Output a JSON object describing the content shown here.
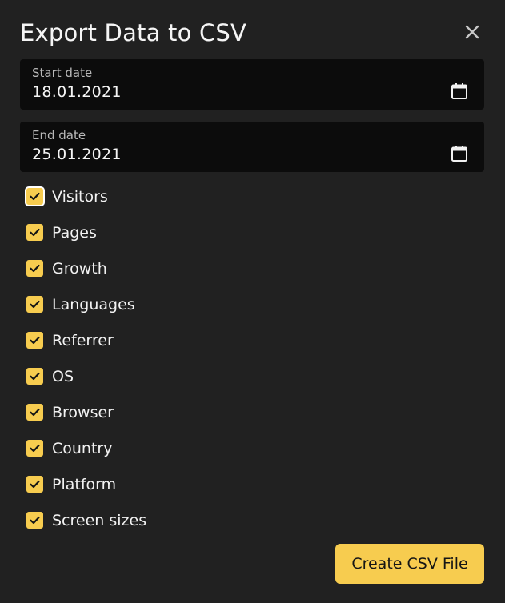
{
  "dialog": {
    "title": "Export Data to CSV",
    "close_icon": "close-icon"
  },
  "start_date": {
    "label": "Start date",
    "value": "18.01.2021",
    "icon": "calendar-icon"
  },
  "end_date": {
    "label": "End date",
    "value": "25.01.2021",
    "icon": "calendar-icon"
  },
  "options": [
    {
      "label": "Visitors",
      "checked": true,
      "focused": true
    },
    {
      "label": "Pages",
      "checked": true
    },
    {
      "label": "Growth",
      "checked": true
    },
    {
      "label": "Languages",
      "checked": true
    },
    {
      "label": "Referrer",
      "checked": true
    },
    {
      "label": "OS",
      "checked": true
    },
    {
      "label": "Browser",
      "checked": true
    },
    {
      "label": "Country",
      "checked": true
    },
    {
      "label": "Platform",
      "checked": true
    },
    {
      "label": "Screen sizes",
      "checked": true
    }
  ],
  "actions": {
    "create_label": "Create CSV File"
  },
  "colors": {
    "background": "#212121",
    "field_background": "#0c0c0c",
    "accent": "#f7cc4f",
    "text": "#f2f2f2",
    "muted_text": "#b9b9b9"
  }
}
